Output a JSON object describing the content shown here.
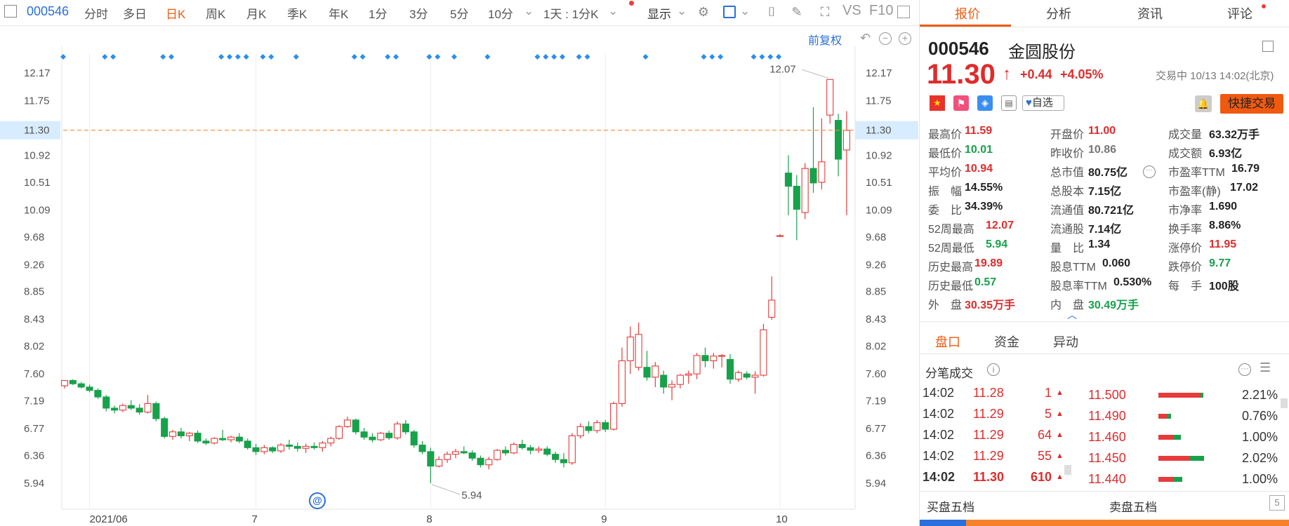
{
  "toolbar": {
    "code": "000546",
    "periods": [
      "分时",
      "多日",
      "日K",
      "周K",
      "月K",
      "季K",
      "年K",
      "1分",
      "3分",
      "5分",
      "10分"
    ],
    "active_period": "日K",
    "interval": "1天 : 1分K",
    "display": "显示",
    "vs": "VS",
    "f10": "F10"
  },
  "chart": {
    "adjust_label": "前复权",
    "current_price_tag": "11.30",
    "high_label": "12.07",
    "low_label": "5.94",
    "marker_glyph": "@"
  },
  "chart_data": {
    "type": "candlestick",
    "title": "",
    "y_ticks": [
      12.17,
      11.75,
      11.3,
      10.92,
      10.51,
      10.09,
      9.68,
      9.26,
      8.85,
      8.43,
      8.02,
      7.6,
      7.19,
      6.77,
      6.36,
      5.94
    ],
    "ylim": [
      5.6,
      12.5
    ],
    "x_tick_labels": [
      "2021/06",
      "7",
      "8",
      "9",
      "10"
    ],
    "x_tick_index": [
      3,
      23,
      44,
      65,
      86
    ],
    "reference_price": 11.3,
    "candles": [
      [
        7.42,
        7.5,
        7.38,
        7.5
      ],
      [
        7.5,
        7.52,
        7.43,
        7.45
      ],
      [
        7.45,
        7.48,
        7.38,
        7.4
      ],
      [
        7.4,
        7.44,
        7.32,
        7.35
      ],
      [
        7.35,
        7.38,
        7.22,
        7.25
      ],
      [
        7.25,
        7.28,
        7.03,
        7.08
      ],
      [
        7.08,
        7.12,
        7.0,
        7.05
      ],
      [
        7.05,
        7.15,
        7.02,
        7.12
      ],
      [
        7.12,
        7.2,
        7.05,
        7.08
      ],
      [
        7.08,
        7.14,
        6.98,
        7.02
      ],
      [
        7.02,
        7.28,
        7.0,
        7.15
      ],
      [
        7.15,
        7.18,
        6.88,
        6.92
      ],
      [
        6.92,
        6.95,
        6.62,
        6.65
      ],
      [
        6.65,
        6.75,
        6.6,
        6.72
      ],
      [
        6.72,
        6.78,
        6.62,
        6.66
      ],
      [
        6.66,
        6.72,
        6.58,
        6.7
      ],
      [
        6.7,
        6.74,
        6.55,
        6.58
      ],
      [
        6.58,
        6.62,
        6.52,
        6.55
      ],
      [
        6.55,
        6.64,
        6.53,
        6.62
      ],
      [
        6.62,
        6.75,
        6.58,
        6.6
      ],
      [
        6.6,
        6.66,
        6.56,
        6.64
      ],
      [
        6.64,
        6.7,
        6.55,
        6.58
      ],
      [
        6.58,
        6.62,
        6.45,
        6.48
      ],
      [
        6.48,
        6.54,
        6.37,
        6.42
      ],
      [
        6.42,
        6.52,
        6.38,
        6.48
      ],
      [
        6.48,
        6.5,
        6.4,
        6.43
      ],
      [
        6.43,
        6.55,
        6.4,
        6.52
      ],
      [
        6.52,
        6.6,
        6.45,
        6.5
      ],
      [
        6.5,
        6.56,
        6.42,
        6.47
      ],
      [
        6.47,
        6.54,
        6.4,
        6.5
      ],
      [
        6.5,
        6.56,
        6.45,
        6.48
      ],
      [
        6.48,
        6.58,
        6.42,
        6.55
      ],
      [
        6.55,
        6.65,
        6.5,
        6.62
      ],
      [
        6.62,
        6.82,
        6.6,
        6.8
      ],
      [
        6.8,
        6.95,
        6.78,
        6.9
      ],
      [
        6.9,
        6.92,
        6.68,
        6.72
      ],
      [
        6.72,
        6.78,
        6.6,
        6.64
      ],
      [
        6.64,
        6.7,
        6.56,
        6.6
      ],
      [
        6.6,
        6.72,
        6.58,
        6.7
      ],
      [
        6.7,
        6.74,
        6.6,
        6.63
      ],
      [
        6.63,
        6.88,
        6.6,
        6.84
      ],
      [
        6.84,
        6.9,
        6.68,
        6.72
      ],
      [
        6.72,
        6.75,
        6.48,
        6.52
      ],
      [
        6.52,
        6.58,
        6.38,
        6.42
      ],
      [
        6.42,
        6.48,
        5.94,
        6.2
      ],
      [
        6.2,
        6.35,
        6.18,
        6.3
      ],
      [
        6.3,
        6.42,
        6.25,
        6.38
      ],
      [
        6.38,
        6.46,
        6.32,
        6.42
      ],
      [
        6.42,
        6.5,
        6.38,
        6.4
      ],
      [
        6.4,
        6.44,
        6.28,
        6.32
      ],
      [
        6.32,
        6.36,
        6.18,
        6.22
      ],
      [
        6.22,
        6.34,
        6.15,
        6.3
      ],
      [
        6.3,
        6.46,
        6.28,
        6.44
      ],
      [
        6.44,
        6.5,
        6.36,
        6.4
      ],
      [
        6.4,
        6.56,
        6.38,
        6.53
      ],
      [
        6.53,
        6.6,
        6.45,
        6.48
      ],
      [
        6.48,
        6.52,
        6.38,
        6.44
      ],
      [
        6.44,
        6.5,
        6.4,
        6.46
      ],
      [
        6.46,
        6.5,
        6.35,
        6.38
      ],
      [
        6.38,
        6.42,
        6.25,
        6.3
      ],
      [
        6.3,
        6.4,
        6.18,
        6.25
      ],
      [
        6.25,
        6.7,
        6.22,
        6.66
      ],
      [
        6.66,
        6.85,
        6.62,
        6.8
      ],
      [
        6.8,
        6.88,
        6.7,
        6.74
      ],
      [
        6.74,
        6.9,
        6.7,
        6.86
      ],
      [
        6.86,
        6.9,
        6.72,
        6.76
      ],
      [
        6.76,
        7.18,
        6.74,
        7.15
      ],
      [
        7.15,
        8.0,
        7.1,
        7.8
      ],
      [
        7.8,
        8.32,
        7.6,
        8.16
      ],
      [
        7.7,
        8.38,
        7.65,
        8.2
      ],
      [
        7.7,
        7.95,
        7.5,
        7.55
      ],
      [
        7.55,
        7.78,
        7.4,
        7.72
      ],
      [
        7.58,
        7.65,
        7.3,
        7.4
      ],
      [
        7.4,
        7.5,
        7.2,
        7.44
      ],
      [
        7.44,
        7.6,
        7.38,
        7.58
      ],
      [
        7.58,
        7.65,
        7.45,
        7.6
      ],
      [
        7.6,
        7.92,
        7.52,
        7.88
      ],
      [
        7.88,
        8.0,
        7.7,
        7.8
      ],
      [
        7.8,
        7.92,
        7.68,
        7.87
      ],
      [
        7.87,
        7.9,
        7.7,
        7.88
      ],
      [
        7.82,
        7.9,
        7.45,
        7.52
      ],
      [
        7.52,
        7.65,
        7.48,
        7.62
      ],
      [
        7.6,
        7.64,
        7.52,
        7.55
      ],
      [
        7.55,
        7.64,
        7.3,
        7.58
      ],
      [
        7.58,
        8.36,
        7.56,
        8.27
      ],
      [
        8.46,
        9.08,
        8.42,
        8.72
      ],
      [
        9.7,
        9.72,
        9.68,
        9.7
      ],
      [
        10.65,
        10.92,
        10.01,
        10.45
      ],
      [
        10.45,
        10.62,
        9.63,
        10.1
      ],
      [
        10.05,
        10.8,
        9.95,
        10.72
      ],
      [
        10.72,
        11.65,
        10.35,
        10.5
      ],
      [
        10.51,
        11.48,
        10.4,
        10.82
      ],
      [
        11.53,
        12.07,
        11.4,
        12.07
      ],
      [
        11.45,
        11.55,
        10.6,
        10.86
      ],
      [
        11.0,
        11.59,
        10.01,
        11.3
      ]
    ]
  },
  "panel": {
    "tabs": [
      "报价",
      "分析",
      "资讯",
      "评论"
    ],
    "active_tab": "报价",
    "code": "000546",
    "name": "金圆股份",
    "price": "11.30",
    "arrow": "↑",
    "change": "+0.44",
    "change_pct": "+4.05%",
    "status_time": "交易中 10/13 14:02(北京)",
    "watch_label": "自选",
    "quick_trade": "快捷交易",
    "quote_rows": [
      [
        [
          "最高价",
          "11.59",
          "red"
        ],
        [
          "开盘价",
          "11.00",
          "red"
        ],
        [
          "成交量",
          "63.32万手",
          "dark"
        ]
      ],
      [
        [
          "最低价",
          "10.01",
          "green"
        ],
        [
          "昨收价",
          "10.86",
          "gray"
        ],
        [
          "成交额",
          "6.93亿",
          "dark"
        ]
      ],
      [
        [
          "平均价",
          "10.94",
          "red"
        ],
        [
          "总市值",
          "80.75亿",
          "dark"
        ],
        [
          "市盈率TTM",
          "16.79",
          "dark"
        ]
      ],
      [
        [
          "振　幅",
          "14.55%",
          "dark"
        ],
        [
          "总股本",
          "7.15亿",
          "dark"
        ],
        [
          "市盈率(静)",
          "17.02",
          "dark"
        ]
      ],
      [
        [
          "委　比",
          "34.39%",
          "dark"
        ],
        [
          "流通值",
          "80.721亿",
          "dark"
        ],
        [
          "市净率",
          "1.690",
          "dark"
        ]
      ],
      [
        [
          "52周最高",
          "12.07",
          "red"
        ],
        [
          "流通股",
          "7.14亿",
          "dark"
        ],
        [
          "换手率",
          "8.86%",
          "dark"
        ]
      ],
      [
        [
          "52周最低",
          "5.94",
          "green"
        ],
        [
          "量　比",
          "1.34",
          "dark"
        ],
        [
          "涨停价",
          "11.95",
          "red"
        ]
      ],
      [
        [
          "历史最高",
          "19.89",
          "red"
        ],
        [
          "股息TTM",
          "0.060",
          "dark"
        ],
        [
          "跌停价",
          "9.77",
          "green"
        ]
      ],
      [
        [
          "历史最低",
          "0.57",
          "green"
        ],
        [
          "股息率TTM",
          "0.530%",
          "dark"
        ],
        [
          "每　手",
          "100股",
          "dark"
        ]
      ],
      [
        [
          "外　盘",
          "30.35万手",
          "red"
        ],
        [
          "内　盘",
          "30.49万手",
          "green"
        ],
        [
          "",
          "",
          " "
        ]
      ]
    ],
    "subtabs": [
      "盘口",
      "资金",
      "异动"
    ],
    "active_subtab": "盘口",
    "ticks_title": "分笔成交",
    "ticks": [
      {
        "time": "14:02",
        "price": "11.28",
        "vol": "1",
        "depth_price": "11.500",
        "pct": "2.21%",
        "r": 60,
        "g": 4
      },
      {
        "time": "14:02",
        "price": "11.29",
        "vol": "5",
        "depth_price": "11.490",
        "pct": "0.76%",
        "r": 12,
        "g": 6
      },
      {
        "time": "14:02",
        "price": "11.29",
        "vol": "64",
        "depth_price": "11.460",
        "pct": "1.00%",
        "r": 22,
        "g": 10
      },
      {
        "time": "14:02",
        "price": "11.29",
        "vol": "55",
        "depth_price": "11.450",
        "pct": "2.02%",
        "r": 45,
        "g": 20
      },
      {
        "time": "14:02",
        "price": "11.30",
        "vol": "610",
        "depth_price": "11.440",
        "pct": "1.00%",
        "r": 22,
        "g": 12
      }
    ],
    "bid_title": "买盘五档",
    "ask_title": "卖盘五档"
  }
}
